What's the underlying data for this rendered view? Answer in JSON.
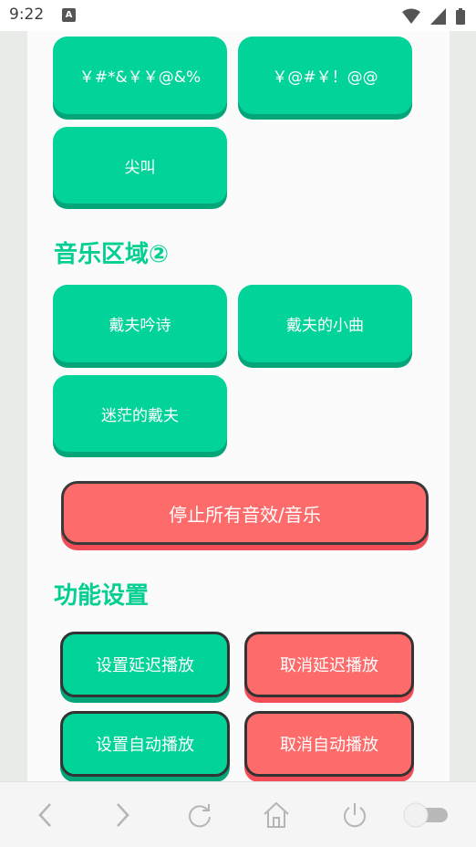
{
  "status_bar": {
    "time": "9:22",
    "notification_icon": "a-icon",
    "wifi_icon": "wifi-icon",
    "signal_icon": "signal-icon",
    "battery_icon": "battery-icon"
  },
  "sections": {
    "sound_buttons_top": [
      {
        "label": "￥#*&￥￥@&%"
      },
      {
        "label": "￥@#￥！@@"
      },
      {
        "label": "尖叫"
      }
    ],
    "music_area_2": {
      "title": "音乐区域②",
      "buttons": [
        {
          "label": "戴夫吟诗"
        },
        {
          "label": "戴夫的小曲"
        },
        {
          "label": "迷茫的戴夫"
        }
      ]
    },
    "stop_all_label": "停止所有音效/音乐",
    "settings": {
      "title": "功能设置",
      "buttons": [
        {
          "label": "设置延迟播放",
          "variant": "green"
        },
        {
          "label": "取消延迟播放",
          "variant": "red"
        },
        {
          "label": "设置自动播放",
          "variant": "green"
        },
        {
          "label": "取消自动播放",
          "variant": "red"
        }
      ]
    }
  },
  "nav_bar": {
    "icons": [
      "back-icon",
      "forward-icon",
      "refresh-icon",
      "home-icon",
      "power-icon",
      "toggle-switch"
    ]
  },
  "colors": {
    "green": "#01d399",
    "green_shadow": "#05a57a",
    "red": "#fe6b6b",
    "red_shadow": "#f34d57",
    "title_green": "#04cf93"
  }
}
